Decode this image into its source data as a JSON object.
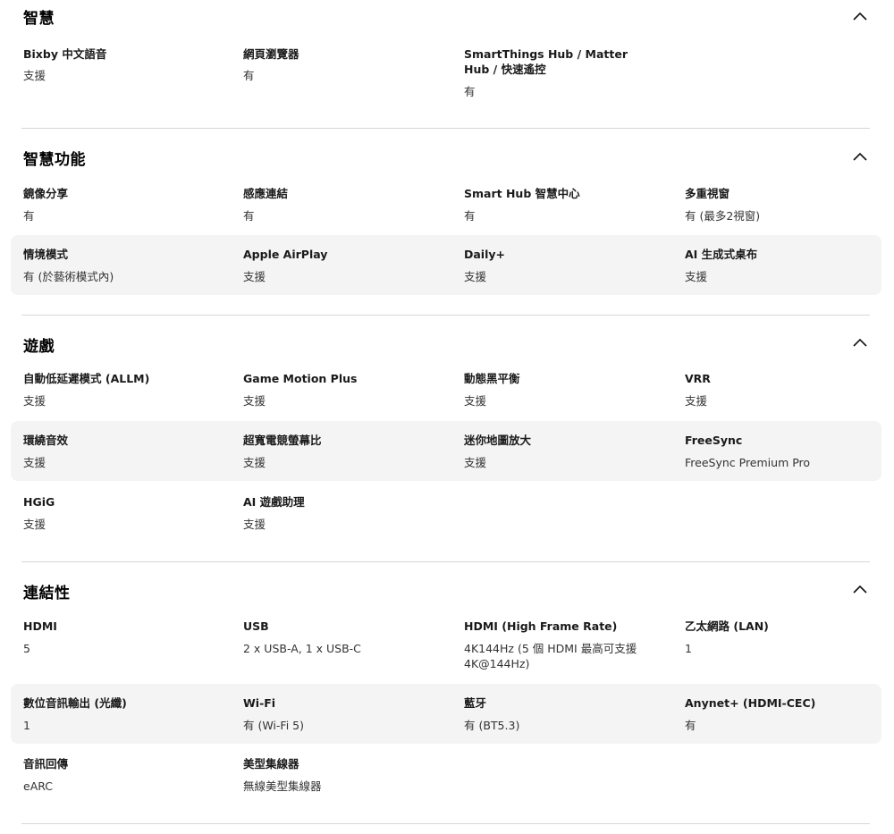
{
  "sections": [
    {
      "title": "智慧",
      "items": [
        {
          "label": "Bixby 中文語音",
          "value": "支援"
        },
        {
          "label": "網頁瀏覽器",
          "value": "有"
        },
        {
          "label": "SmartThings Hub / Matter Hub / 快速遙控",
          "value": "有"
        }
      ]
    },
    {
      "title": "智慧功能",
      "items": [
        {
          "label": "鏡像分享",
          "value": "有"
        },
        {
          "label": "感應連結",
          "value": "有"
        },
        {
          "label": "Smart Hub 智慧中心",
          "value": "有"
        },
        {
          "label": "多重視窗",
          "value": "有 (最多2視窗)"
        },
        {
          "label": "情境模式",
          "value": "有 (於藝術模式內)"
        },
        {
          "label": "Apple AirPlay",
          "value": "支援"
        },
        {
          "label": "Daily+",
          "value": "支援"
        },
        {
          "label": "AI 生成式桌布",
          "value": "支援"
        }
      ]
    },
    {
      "title": "遊戲",
      "items": [
        {
          "label": "自動低延遲模式 (ALLM)",
          "value": "支援"
        },
        {
          "label": "Game Motion Plus",
          "value": "支援"
        },
        {
          "label": "動態黑平衡",
          "value": "支援"
        },
        {
          "label": "VRR",
          "value": "支援"
        },
        {
          "label": "環繞音效",
          "value": "支援"
        },
        {
          "label": "超寬電競螢幕比",
          "value": "支援"
        },
        {
          "label": "迷你地圖放大",
          "value": "支援"
        },
        {
          "label": "FreeSync",
          "value": "FreeSync Premium Pro"
        },
        {
          "label": "HGiG",
          "value": "支援"
        },
        {
          "label": "AI 遊戲助理",
          "value": "支援"
        }
      ]
    },
    {
      "title": "連結性",
      "items": [
        {
          "label": "HDMI",
          "value": "5"
        },
        {
          "label": "USB",
          "value": "2 x USB-A, 1 x USB-C"
        },
        {
          "label": "HDMI (High Frame Rate)",
          "value": "4K144Hz (5 個 HDMI 最高可支援 4K@144Hz)"
        },
        {
          "label": "乙太網路 (LAN)",
          "value": "1"
        },
        {
          "label": "數位音訊輸出 (光纖)",
          "value": "1"
        },
        {
          "label": "Wi-Fi",
          "value": "有 (Wi-Fi 5)"
        },
        {
          "label": "藍牙",
          "value": "有 (BT5.3)"
        },
        {
          "label": "Anynet+ (HDMI-CEC)",
          "value": "有"
        },
        {
          "label": "音訊回傳",
          "value": "eARC"
        },
        {
          "label": "美型集線器",
          "value": "無線美型集線器"
        }
      ]
    }
  ],
  "icons": {
    "collapse": "chevron-up-icon"
  }
}
